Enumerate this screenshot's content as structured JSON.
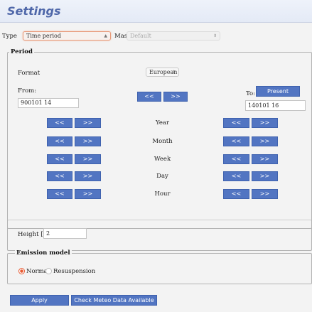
{
  "title": "Settings",
  "type_row": {
    "type_label": "Type",
    "type_value": "Time period",
    "mast_label": "Mast",
    "mast_value": "Default"
  },
  "period": {
    "legend": "Period",
    "format_label": "Format",
    "format_value": "European",
    "from_label": "From:",
    "from_value": "900101 14",
    "to_label": "To:",
    "to_value": "140101 16",
    "present_label": "Present",
    "prev_label": "<<",
    "next_label": ">>",
    "steps": [
      "Year",
      "Month",
      "Week",
      "Day",
      "Hour"
    ]
  },
  "height": {
    "label": "Height [m]",
    "value": "2"
  },
  "emission": {
    "legend": "Emission model",
    "options": [
      "Normal",
      "Resuspension"
    ],
    "selected": "Normal"
  },
  "actions": {
    "apply_label": "Apply",
    "check_label": "Check Meteo Data Available"
  },
  "colors": {
    "button": "#5275c2",
    "title": "#4f67a9",
    "radio_selected": "#e85a32"
  }
}
